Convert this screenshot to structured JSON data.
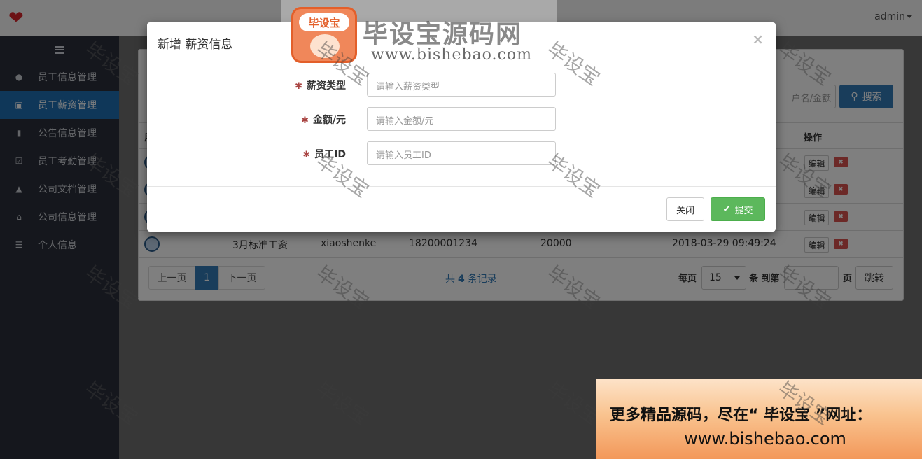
{
  "header": {
    "user": "admin"
  },
  "sidebar": {
    "items": [
      {
        "label": "员工信息管理",
        "icon": "user-icon"
      },
      {
        "label": "员工薪资管理",
        "icon": "credit-card-icon",
        "active": true
      },
      {
        "label": "公告信息管理",
        "icon": "book-icon"
      },
      {
        "label": "员工考勤管理",
        "icon": "check-square-icon"
      },
      {
        "label": "公司文档管理",
        "icon": "folder-open-icon"
      },
      {
        "label": "公司信息管理",
        "icon": "home-icon"
      },
      {
        "label": "个人信息",
        "icon": "list-icon"
      }
    ]
  },
  "toolbar": {
    "search_placeholder": "户名/金额",
    "search_label": "搜索"
  },
  "table": {
    "columns": {
      "first": "用",
      "op": "操作"
    },
    "row": {
      "salary_type": "3月标准工资",
      "username": "xiaoshenke",
      "phone": "18200001234",
      "amount": "20000",
      "time": "2018-03-29 09:49:24"
    },
    "edit_label": "编辑"
  },
  "pager": {
    "prev": "上一页",
    "current": "1",
    "next": "下一页",
    "total_prefix": "共",
    "total_count": "4",
    "total_suffix": "条记录",
    "per_page_label": "每页",
    "per_page_value": "15",
    "per_page_suffix": "条 到第",
    "jump_suffix": "页",
    "jump_label": "跳转"
  },
  "modal": {
    "title": "新增 薪资信息",
    "close_symbol": "×",
    "fields": [
      {
        "label": "薪资类型",
        "placeholder": "请输入薪资类型"
      },
      {
        "label": "金额/元",
        "placeholder": "请输入金额/元"
      },
      {
        "label": "员工ID",
        "placeholder": "请输入员工ID"
      }
    ],
    "close_label": "关闭",
    "submit_label": "提交"
  },
  "watermark": {
    "text": "毕设宝",
    "brand_badge": "毕设宝",
    "brand_title": "毕设宝源码网",
    "brand_url": "www.bishebao.com"
  },
  "promo": {
    "line1": "更多精品源码，尽在“ 毕设宝 ”网址：",
    "line2": "www.bishebao.com"
  },
  "colors": {
    "accent": "#337ab7",
    "success": "#5cb85c",
    "danger": "#d9534f",
    "sidebar": "#2b2f3a"
  }
}
